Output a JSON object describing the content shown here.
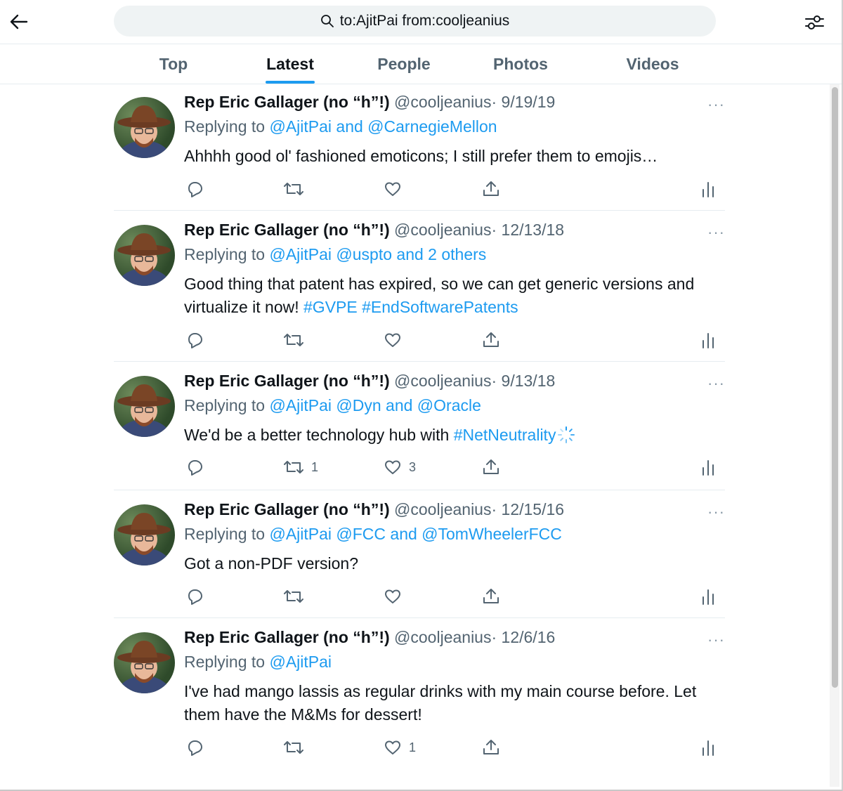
{
  "search": {
    "query": "to:AjitPai from:cooljeanius"
  },
  "tabs": [
    {
      "label": "Top",
      "active": false
    },
    {
      "label": "Latest",
      "active": true
    },
    {
      "label": "People",
      "active": false
    },
    {
      "label": "Photos",
      "active": false
    },
    {
      "label": "Videos",
      "active": false
    }
  ],
  "colors": {
    "accent": "#1d9bf0",
    "text": "#0f1419",
    "secondary": "#536471"
  },
  "tweets": [
    {
      "name": "Rep Eric Gallager (no “h”!)",
      "handle": "@cooljeanius",
      "date": "· 9/19/19",
      "more": "···",
      "replying_prefix": "Replying to ",
      "replying_targets": "@AjitPai and @CarnegieMellon",
      "text": "Ahhhh good ol' fashioned emoticons; I still prefer them to emojis…",
      "retweets": "",
      "likes": ""
    },
    {
      "name": "Rep Eric Gallager (no “h”!)",
      "handle": "@cooljeanius",
      "date": "· 12/13/18",
      "more": "···",
      "replying_prefix": "Replying to ",
      "replying_targets": "@AjitPai @uspto and 2 others",
      "text_plain": "Good thing that patent has expired, so we can get generic versions and virtualize it now! ",
      "text_tags": "#GVPE #EndSoftwarePatents",
      "retweets": "",
      "likes": ""
    },
    {
      "name": "Rep Eric Gallager (no “h”!)",
      "handle": "@cooljeanius",
      "date": "· 9/13/18",
      "more": "···",
      "replying_prefix": "Replying to ",
      "replying_targets": "@AjitPai @Dyn and @Oracle",
      "text_plain": "We'd be a better technology hub with ",
      "text_tags": "#NetNeutrality",
      "retweets": "1",
      "likes": "3"
    },
    {
      "name": "Rep Eric Gallager (no “h”!)",
      "handle": "@cooljeanius",
      "date": "· 12/15/16",
      "more": "···",
      "replying_prefix": "Replying to ",
      "replying_targets": "@AjitPai @FCC and @TomWheelerFCC",
      "text": "Got a non-PDF version?",
      "retweets": "",
      "likes": ""
    },
    {
      "name": "Rep Eric Gallager (no “h”!)",
      "handle": "@cooljeanius",
      "date": "· 12/6/16",
      "more": "···",
      "replying_prefix": "Replying to ",
      "replying_targets": "@AjitPai",
      "text": "I've had mango lassis as regular drinks with my main course before. Let them have the M&Ms for dessert!",
      "retweets": "",
      "likes": "1"
    }
  ]
}
